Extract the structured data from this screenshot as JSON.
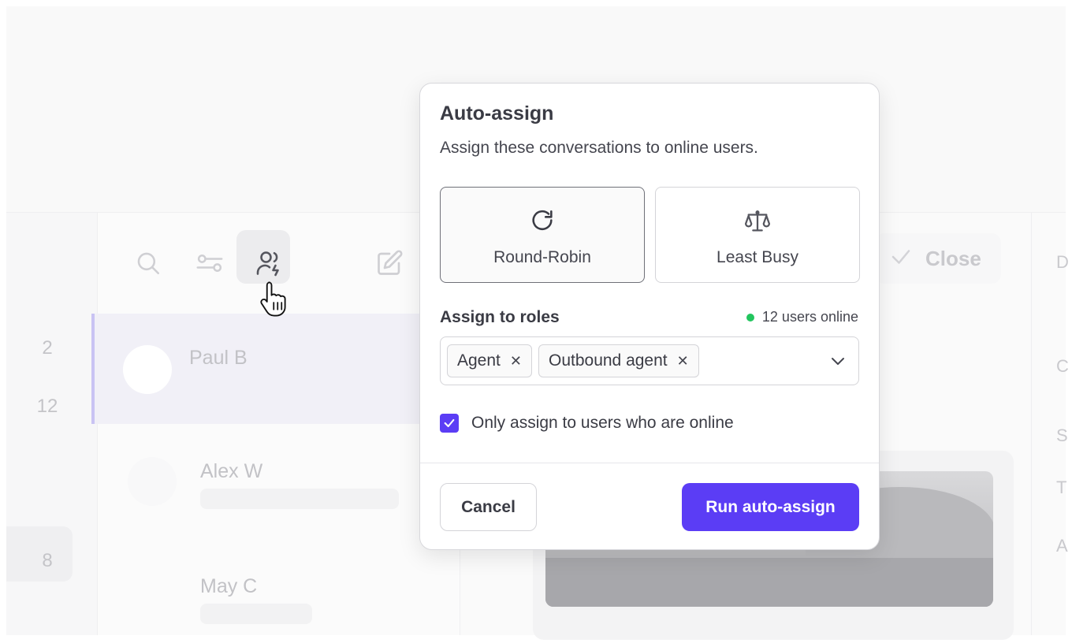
{
  "background": {
    "rail_counts": [
      "2",
      "12",
      "8"
    ],
    "conversations": [
      {
        "name": "Paul B"
      },
      {
        "name": "Alex W"
      },
      {
        "name": "May C"
      }
    ],
    "close_button_label": "Close",
    "right_letters": [
      "D",
      "C",
      "S",
      "T",
      "A"
    ],
    "icons": [
      "search-icon",
      "filter-icon",
      "auto-assign-icon",
      "compose-icon",
      "check-icon"
    ]
  },
  "popover": {
    "title": "Auto-assign",
    "subtitle": "Assign these conversations to online users.",
    "strategies": [
      {
        "label": "Round-Robin",
        "icon": "rotate-cw-icon",
        "selected": true
      },
      {
        "label": "Least Busy",
        "icon": "scale-icon",
        "selected": false
      }
    ],
    "roles_label": "Assign to roles",
    "online_status": "12 users online",
    "online_color": "#22c55e",
    "roles": [
      {
        "label": "Agent"
      },
      {
        "label": "Outbound agent"
      }
    ],
    "remove_glyph": "✕",
    "only_online_label": "Only assign to users who are online",
    "only_online_checked": true,
    "cancel_label": "Cancel",
    "run_label": "Run auto-assign",
    "accent_color": "#5b3df5"
  }
}
